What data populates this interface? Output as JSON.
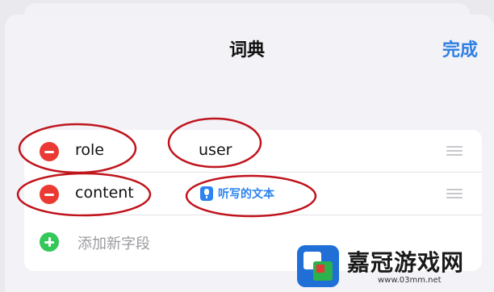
{
  "nav": {
    "title": "词典",
    "done_label": "完成"
  },
  "fields": [
    {
      "key": "role",
      "value": "user"
    },
    {
      "key": "content",
      "value": "听写的文本"
    }
  ],
  "add_field_label": "添加新字段",
  "colors": {
    "accent": "#2f7fe3",
    "delete": "#ea3a33",
    "add": "#34c759",
    "annotation_circle": "#c0141c"
  },
  "watermark": {
    "title": "嘉冠游戏网",
    "url": "www.03mm.net"
  }
}
